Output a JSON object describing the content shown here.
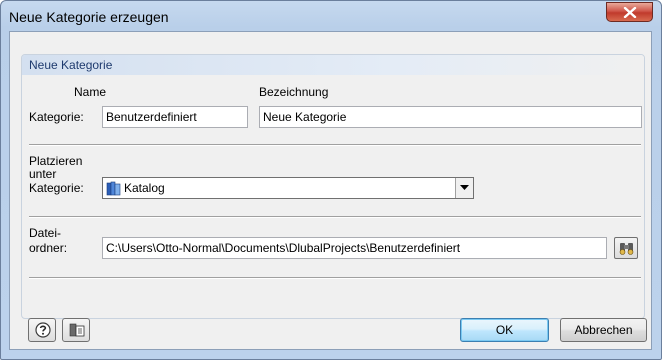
{
  "window": {
    "title": "Neue Kategorie erzeugen"
  },
  "group": {
    "title": "Neue Kategorie"
  },
  "fields": {
    "kategorie_label": "Kategorie:",
    "name_header": "Name",
    "bezeichnung_header": "Bezeichnung",
    "name_value": "Benutzerdefiniert",
    "bezeichnung_value": "Neue Kategorie",
    "platzieren_label_1": "Platzieren",
    "platzieren_label_2": "unter",
    "platzieren_label_3": "Kategorie:",
    "platzieren_value": "Katalog",
    "ordner_label_1": "Datei-",
    "ordner_label_2": "ordner:",
    "ordner_value": "C:\\Users\\Otto-Normal\\Documents\\DlubalProjects\\Benutzerdefiniert"
  },
  "buttons": {
    "ok": "OK",
    "cancel": "Abbrechen"
  },
  "icons": {
    "close": "close-icon",
    "category": "category-folder-icon",
    "dropdown": "chevron-down-icon",
    "browse": "binoculars-icon",
    "help": "help-icon",
    "details": "details-icon"
  },
  "colors": {
    "accent": "#1e3a6e",
    "close_button": "#c03a2c",
    "default_button": "#3c7fb1"
  }
}
